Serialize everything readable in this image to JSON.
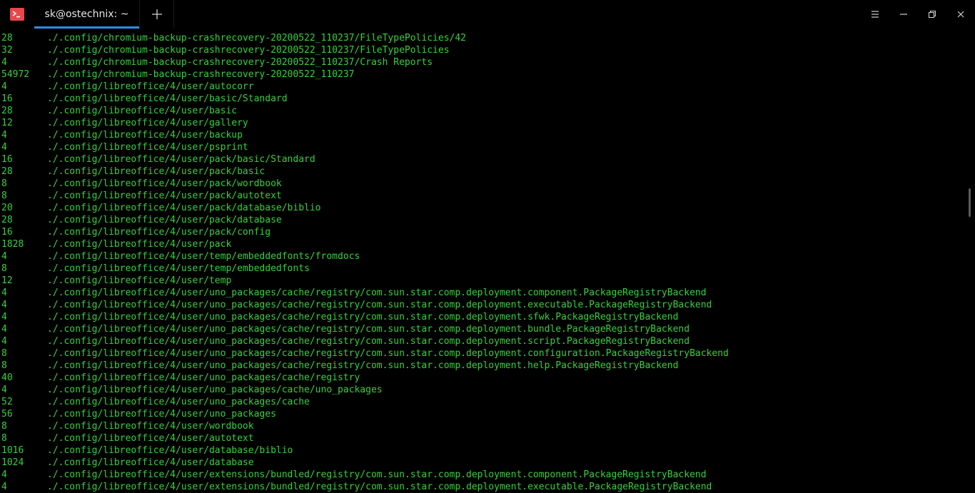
{
  "window": {
    "tab_title": "sk@ostechnix: ~"
  },
  "icons": {
    "app": "terminal-icon",
    "new_tab": "plus-icon",
    "menu": "hamburger-menu-icon",
    "minimize": "minimize-icon",
    "maximize": "restore-icon",
    "close": "close-icon"
  },
  "colors": {
    "background": "#000000",
    "text": "#36d13a",
    "tab_accent": "#2f8de4",
    "icon_red": "#e8484b"
  },
  "terminal": {
    "partial_top": "                                                                                                                                                    ",
    "lines": [
      {
        "size": "28",
        "path": "./.config/chromium-backup-crashrecovery-20200522_110237/FileTypePolicies/42"
      },
      {
        "size": "32",
        "path": "./.config/chromium-backup-crashrecovery-20200522_110237/FileTypePolicies"
      },
      {
        "size": "4",
        "path": "./.config/chromium-backup-crashrecovery-20200522_110237/Crash Reports"
      },
      {
        "size": "54972",
        "path": "./.config/chromium-backup-crashrecovery-20200522_110237"
      },
      {
        "size": "4",
        "path": "./.config/libreoffice/4/user/autocorr"
      },
      {
        "size": "16",
        "path": "./.config/libreoffice/4/user/basic/Standard"
      },
      {
        "size": "28",
        "path": "./.config/libreoffice/4/user/basic"
      },
      {
        "size": "12",
        "path": "./.config/libreoffice/4/user/gallery"
      },
      {
        "size": "4",
        "path": "./.config/libreoffice/4/user/backup"
      },
      {
        "size": "4",
        "path": "./.config/libreoffice/4/user/psprint"
      },
      {
        "size": "16",
        "path": "./.config/libreoffice/4/user/pack/basic/Standard"
      },
      {
        "size": "28",
        "path": "./.config/libreoffice/4/user/pack/basic"
      },
      {
        "size": "8",
        "path": "./.config/libreoffice/4/user/pack/wordbook"
      },
      {
        "size": "8",
        "path": "./.config/libreoffice/4/user/pack/autotext"
      },
      {
        "size": "20",
        "path": "./.config/libreoffice/4/user/pack/database/biblio"
      },
      {
        "size": "28",
        "path": "./.config/libreoffice/4/user/pack/database"
      },
      {
        "size": "16",
        "path": "./.config/libreoffice/4/user/pack/config"
      },
      {
        "size": "1828",
        "path": "./.config/libreoffice/4/user/pack"
      },
      {
        "size": "4",
        "path": "./.config/libreoffice/4/user/temp/embeddedfonts/fromdocs"
      },
      {
        "size": "8",
        "path": "./.config/libreoffice/4/user/temp/embeddedfonts"
      },
      {
        "size": "12",
        "path": "./.config/libreoffice/4/user/temp"
      },
      {
        "size": "4",
        "path": "./.config/libreoffice/4/user/uno_packages/cache/registry/com.sun.star.comp.deployment.component.PackageRegistryBackend"
      },
      {
        "size": "4",
        "path": "./.config/libreoffice/4/user/uno_packages/cache/registry/com.sun.star.comp.deployment.executable.PackageRegistryBackend"
      },
      {
        "size": "4",
        "path": "./.config/libreoffice/4/user/uno_packages/cache/registry/com.sun.star.comp.deployment.sfwk.PackageRegistryBackend"
      },
      {
        "size": "4",
        "path": "./.config/libreoffice/4/user/uno_packages/cache/registry/com.sun.star.comp.deployment.bundle.PackageRegistryBackend"
      },
      {
        "size": "4",
        "path": "./.config/libreoffice/4/user/uno_packages/cache/registry/com.sun.star.comp.deployment.script.PackageRegistryBackend"
      },
      {
        "size": "8",
        "path": "./.config/libreoffice/4/user/uno_packages/cache/registry/com.sun.star.comp.deployment.configuration.PackageRegistryBackend"
      },
      {
        "size": "8",
        "path": "./.config/libreoffice/4/user/uno_packages/cache/registry/com.sun.star.comp.deployment.help.PackageRegistryBackend"
      },
      {
        "size": "40",
        "path": "./.config/libreoffice/4/user/uno_packages/cache/registry"
      },
      {
        "size": "4",
        "path": "./.config/libreoffice/4/user/uno_packages/cache/uno_packages"
      },
      {
        "size": "52",
        "path": "./.config/libreoffice/4/user/uno_packages/cache"
      },
      {
        "size": "56",
        "path": "./.config/libreoffice/4/user/uno_packages"
      },
      {
        "size": "8",
        "path": "./.config/libreoffice/4/user/wordbook"
      },
      {
        "size": "8",
        "path": "./.config/libreoffice/4/user/autotext"
      },
      {
        "size": "1016",
        "path": "./.config/libreoffice/4/user/database/biblio"
      },
      {
        "size": "1024",
        "path": "./.config/libreoffice/4/user/database"
      },
      {
        "size": "4",
        "path": "./.config/libreoffice/4/user/extensions/bundled/registry/com.sun.star.comp.deployment.component.PackageRegistryBackend"
      },
      {
        "size": "4",
        "path": "./.config/libreoffice/4/user/extensions/bundled/registry/com.sun.star.comp.deployment.executable.PackageRegistryBackend"
      }
    ]
  }
}
